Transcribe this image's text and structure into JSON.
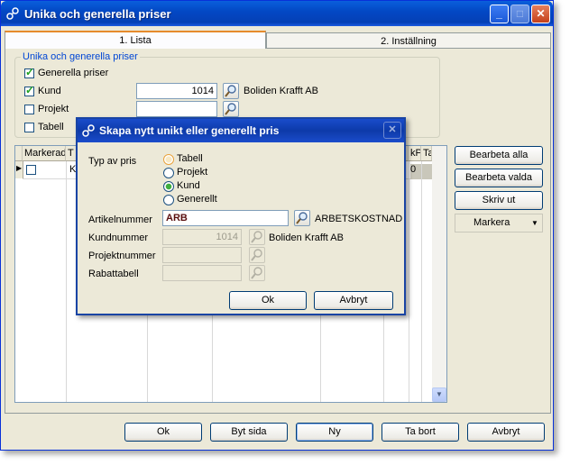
{
  "window": {
    "title": "Unika och generella priser",
    "minimize": "_",
    "maximize": "□",
    "close": "✕"
  },
  "tabs": [
    {
      "label": "1. Lista"
    },
    {
      "label": "2. Inställning"
    }
  ],
  "group": {
    "label": "Unika och generella priser",
    "generella": {
      "label": "Generella priser",
      "checked": true
    },
    "kund": {
      "label": "Kund",
      "checked": true,
      "value": "1014",
      "name": "Boliden Krafft AB"
    },
    "projekt": {
      "label": "Projekt",
      "checked": false,
      "value": ""
    },
    "tabell": {
      "label": "Tabell",
      "checked": false
    }
  },
  "grid": {
    "headers": [
      "Markerad",
      "T",
      "kPri",
      "Ta"
    ],
    "row": {
      "col2": "K",
      "last": "0"
    },
    "scroll_up": "▲",
    "scroll_down": "▼"
  },
  "side_buttons": {
    "bearbeta_alla": "Bearbeta alla",
    "bearbeta_valda": "Bearbeta valda",
    "skriv_ut": "Skriv ut",
    "markera": "Markera",
    "markera_arrow": "▼"
  },
  "bottom_buttons": {
    "ok": "Ok",
    "byt_sida": "Byt sida",
    "ny": "Ny",
    "ta_bort": "Ta bort",
    "avbryt": "Avbryt"
  },
  "dialog": {
    "title": "Skapa nytt unikt eller generellt pris",
    "close": "✕",
    "typ_label": "Typ av pris",
    "options": [
      {
        "label": "Tabell",
        "state": "hover"
      },
      {
        "label": "Projekt",
        "state": "off"
      },
      {
        "label": "Kund",
        "state": "on"
      },
      {
        "label": "Generellt",
        "state": "off"
      }
    ],
    "artikelnummer": {
      "label": "Artikelnummer",
      "value": "ARB",
      "name": "ARBETSKOSTNAD"
    },
    "kundnummer": {
      "label": "Kundnummer",
      "value": "1014",
      "name": "Boliden Krafft AB"
    },
    "projektnummer": {
      "label": "Projektnummer",
      "value": ""
    },
    "rabattabell": {
      "label": "Rabattabell",
      "value": ""
    },
    "ok": "Ok",
    "avbryt": "Avbryt"
  },
  "colors": {
    "title_blue": "#0348c5",
    "window_bg": "#ece9d8",
    "accent_orange": "#e68b2c"
  }
}
